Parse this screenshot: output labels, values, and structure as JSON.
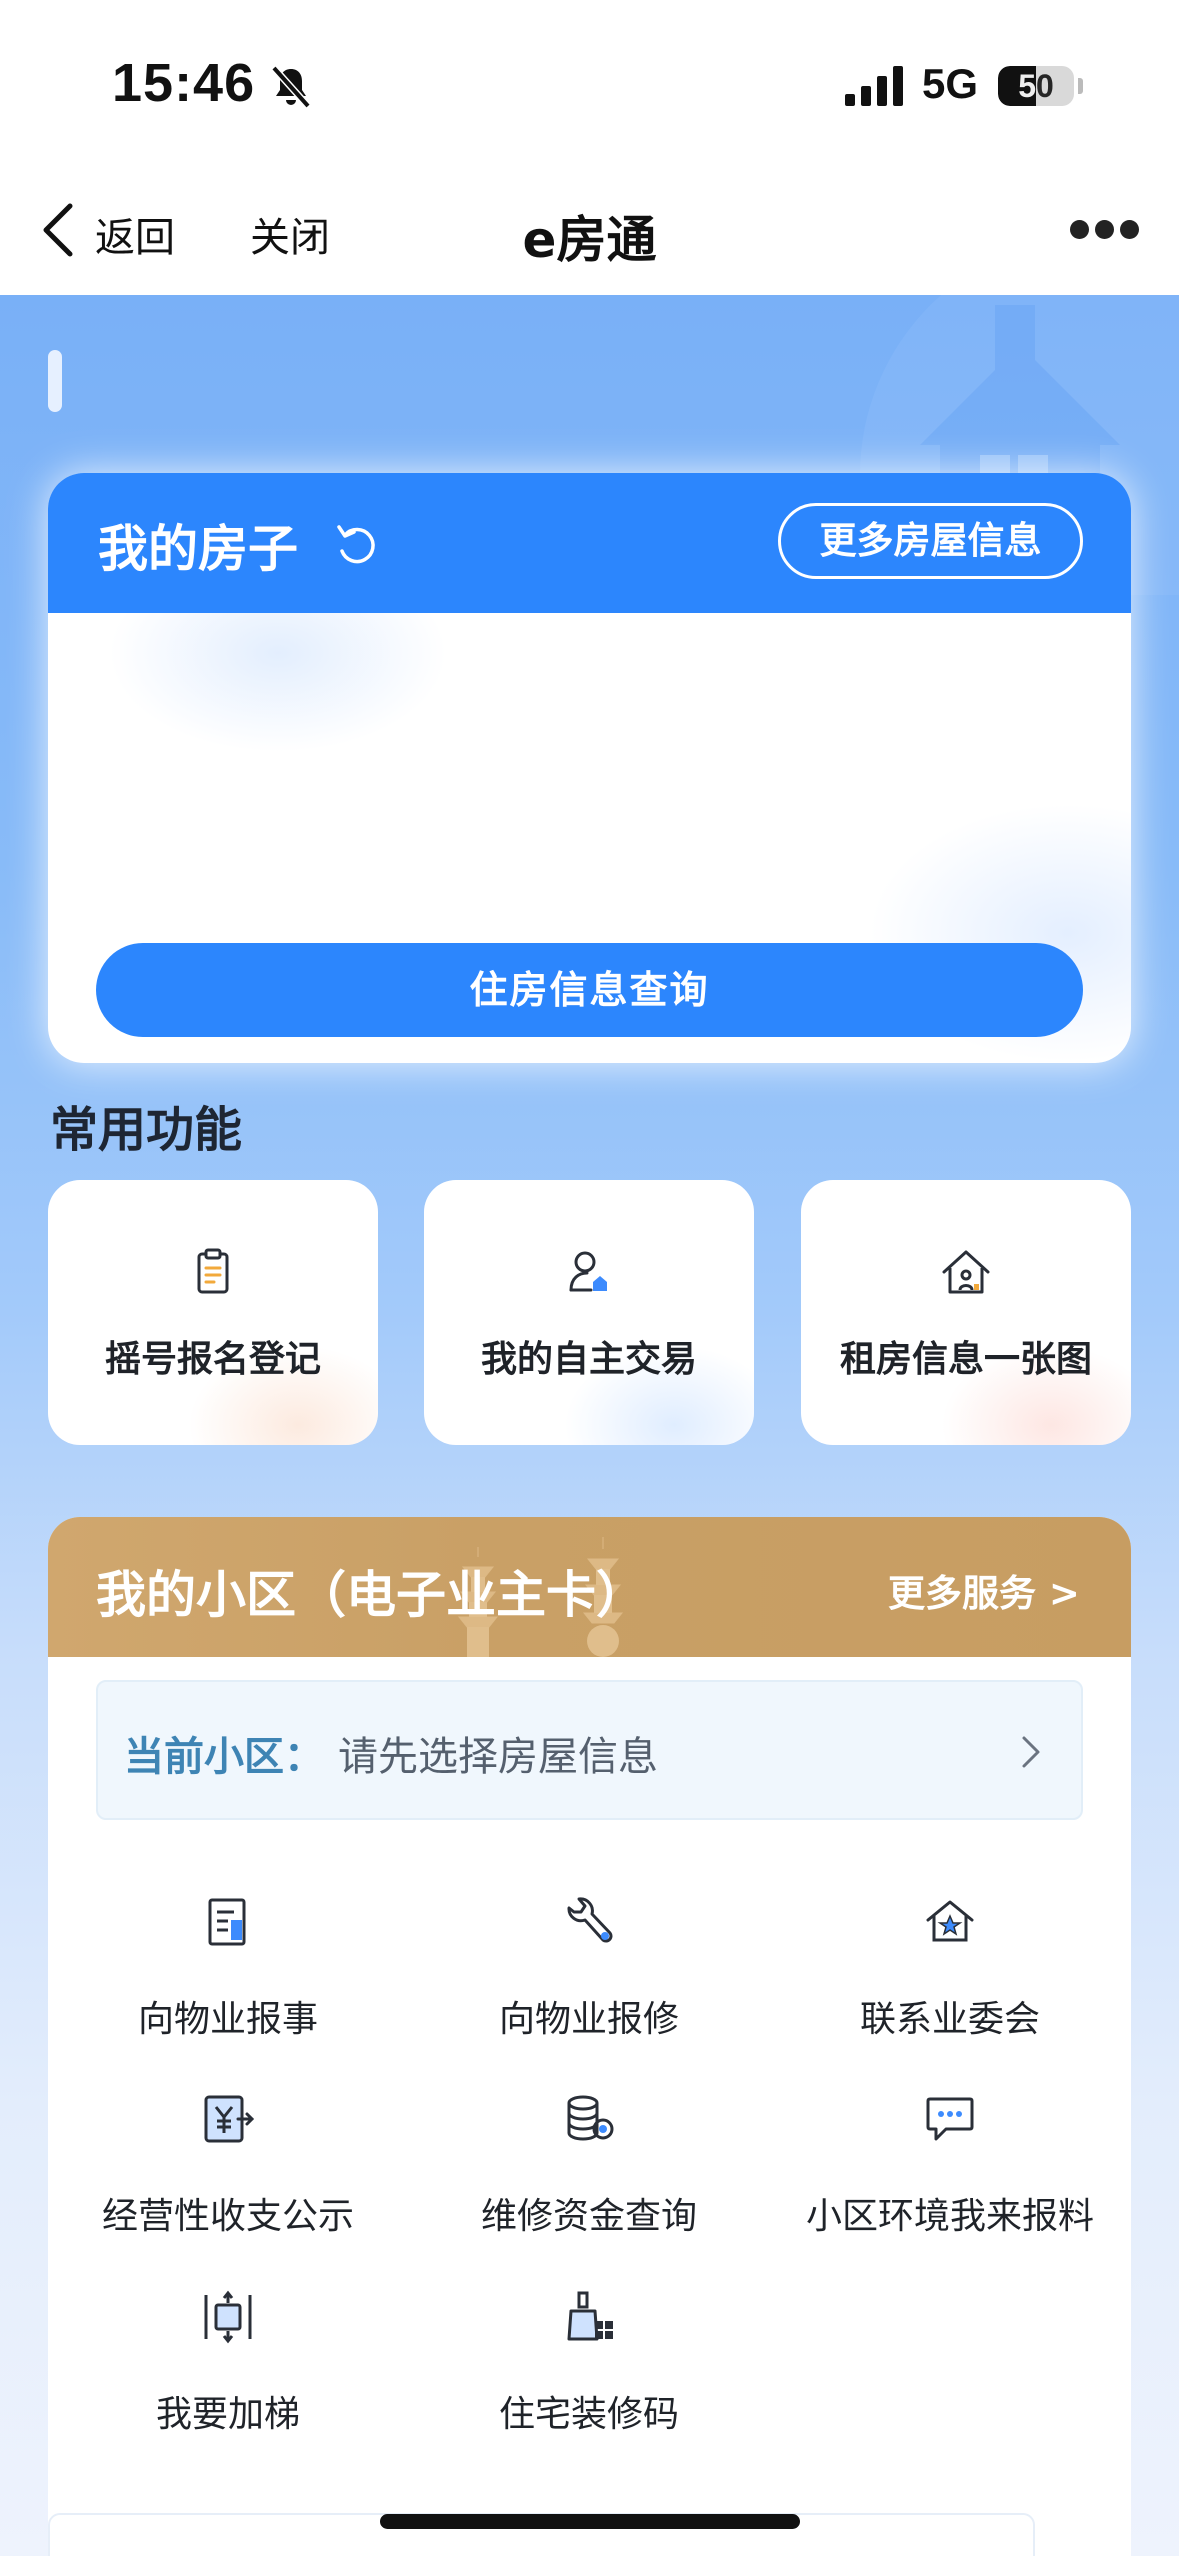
{
  "status_bar": {
    "time": "15:46",
    "network": "5G",
    "battery": "50",
    "battery_level": 0.5
  },
  "nav": {
    "back_label": "返回",
    "close_label": "关闭",
    "title": "e房通"
  },
  "my_house": {
    "title": "我的房子",
    "more_button": "更多房屋信息",
    "query_button": "住房信息查询"
  },
  "common_functions": {
    "title": "常用功能",
    "items": [
      {
        "label": "摇号报名登记",
        "icon": "clipboard-icon"
      },
      {
        "label": "我的自主交易",
        "icon": "person-house-icon"
      },
      {
        "label": "租房信息一张图",
        "icon": "home-outline-icon"
      }
    ]
  },
  "community": {
    "title": "我的小区（电子业主卡）",
    "more_services": "更多服务 >",
    "current_label": "当前小区：",
    "current_value": "请先选择房屋信息",
    "services": [
      {
        "label": "向物业报事",
        "icon": "report-document-icon"
      },
      {
        "label": "向物业报修",
        "icon": "wrench-icon"
      },
      {
        "label": "联系业委会",
        "icon": "star-house-icon"
      },
      {
        "label": "经营性收支公示",
        "icon": "yuan-exchange-icon"
      },
      {
        "label": "维修资金查询",
        "icon": "coins-stack-icon"
      },
      {
        "label": "小区环境我来报料",
        "icon": "chat-bubble-icon"
      },
      {
        "label": "我要加梯",
        "icon": "elevator-icon"
      },
      {
        "label": "住宅装修码",
        "icon": "renovation-broom-icon"
      }
    ]
  },
  "colors": {
    "primary_blue": "#2c86fd",
    "gold_header": "#c9a066",
    "current_label": "#3e84b4"
  }
}
